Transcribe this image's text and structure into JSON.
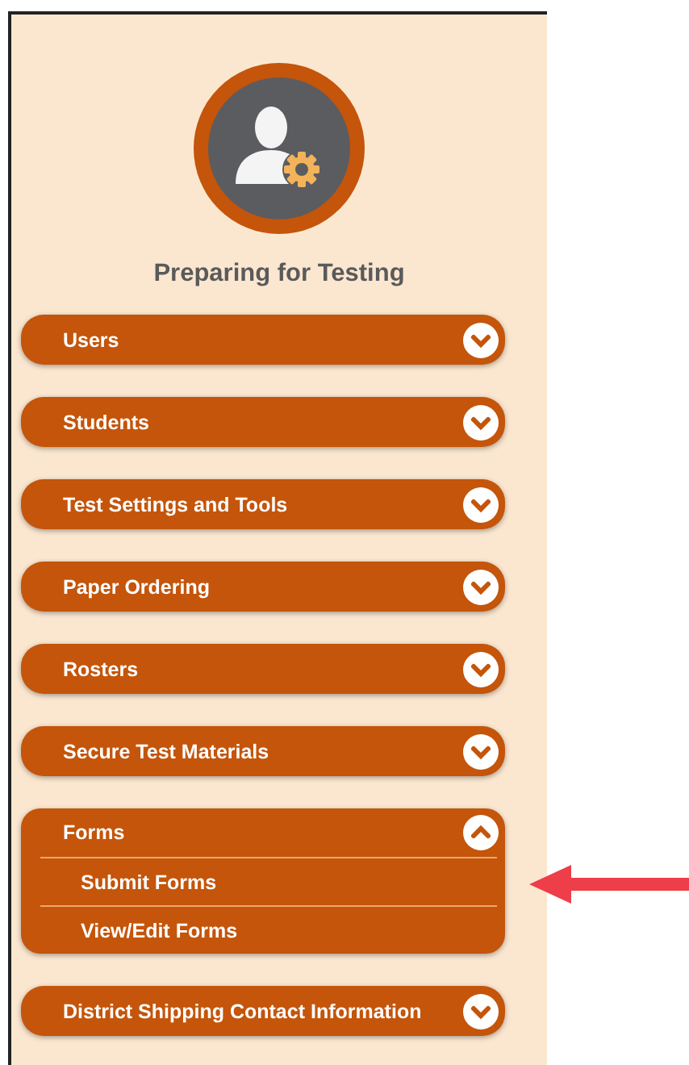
{
  "panel": {
    "title": "Preparing for Testing"
  },
  "sections": [
    {
      "label": "Users",
      "expanded": false
    },
    {
      "label": "Students",
      "expanded": false
    },
    {
      "label": "Test Settings and Tools",
      "expanded": false
    },
    {
      "label": "Paper Ordering",
      "expanded": false
    },
    {
      "label": "Rosters",
      "expanded": false
    },
    {
      "label": "Secure Test Materials",
      "expanded": false
    },
    {
      "label": "Forms",
      "expanded": true,
      "children": [
        {
          "label": "Submit Forms"
        },
        {
          "label": "View/Edit Forms"
        }
      ]
    },
    {
      "label": "District Shipping Contact Information",
      "expanded": false
    }
  ]
}
